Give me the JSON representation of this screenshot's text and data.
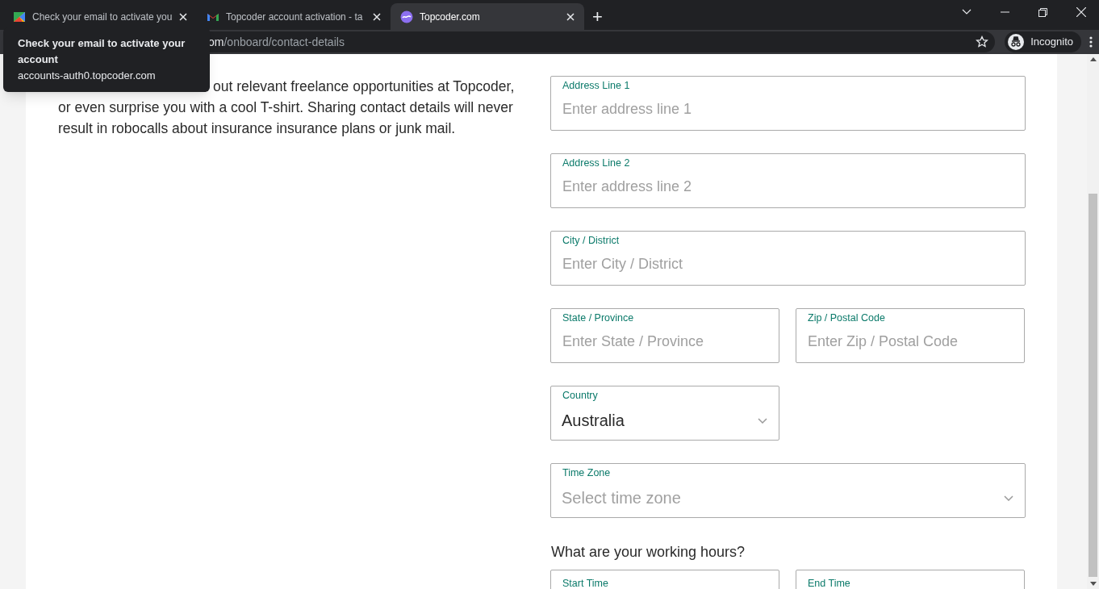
{
  "browser": {
    "tabs": [
      {
        "title": "Check your email to activate you",
        "selected": false
      },
      {
        "title": "Topcoder account activation - ta",
        "selected": false
      },
      {
        "title": "Topcoder.com",
        "selected": true
      }
    ],
    "new_tab": "+",
    "tooltip": {
      "title": "Check your email to activate your account",
      "url": "accounts-auth0.topcoder.com"
    },
    "address": {
      "host_visible": "om",
      "path": "/onboard/contact-details"
    },
    "profile": "Incognito"
  },
  "page": {
    "intro_lines": [
      "out relevant freelance opportunities at Topcoder,",
      "or even surprise you with a cool T-shirt. Sharing contact details will never",
      "result in robocalls about insurance insurance plans or junk mail."
    ],
    "rows": [
      [
        {
          "label": "Address Line 1",
          "kind": "text",
          "placeholder": "Enter address line 1",
          "wide": true
        }
      ],
      [
        {
          "label": "Address Line 2",
          "kind": "text",
          "placeholder": "Enter address line 2",
          "wide": true
        }
      ],
      [
        {
          "label": "City / District",
          "kind": "text",
          "placeholder": "Enter City / District",
          "wide": true
        }
      ],
      [
        {
          "label": "State / Province",
          "kind": "text",
          "placeholder": "Enter State / Province",
          "wide": false
        },
        {
          "label": "Zip / Postal Code",
          "kind": "text",
          "placeholder": "Enter Zip / Postal Code",
          "wide": false
        }
      ],
      [
        {
          "label": "Country",
          "kind": "select",
          "value": "Australia",
          "wide": false
        }
      ],
      [
        {
          "label": "Time Zone",
          "kind": "select",
          "placeholder": "Select time zone",
          "wide": true
        }
      ]
    ],
    "hours_heading": "What are your working hours?",
    "hours_fields": [
      {
        "label": "Start Time"
      },
      {
        "label": "End Time"
      }
    ]
  }
}
